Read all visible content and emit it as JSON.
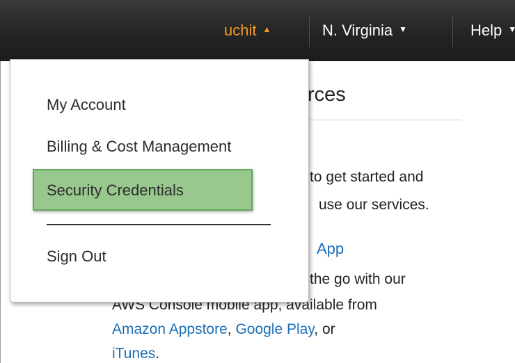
{
  "topbar": {
    "user_label": "uchit",
    "user_caret": "▲",
    "region_label": "N. Virginia",
    "region_caret": "▼",
    "help_label": "Help",
    "help_caret": "▼",
    "colors": {
      "bar": "#262626",
      "user": "#f39a2d"
    }
  },
  "background": {
    "heading": "rces",
    "line1": "to get started and",
    "line2": "use our services.",
    "app_title": "App",
    "app_line1": "the go with our",
    "app_line2": "AWS Console mobile app, available from",
    "store_amazon": "Amazon Appstore",
    "sep1": ", ",
    "store_google": "Google Play",
    "sep2": ", or",
    "store_itunes": "iTunes",
    "end": "."
  },
  "dropdown": {
    "my_account": "My Account",
    "billing": "Billing & Cost Management",
    "security": "Security Credentials",
    "sign_out": "Sign Out",
    "highlight_color": "#99c88e"
  }
}
